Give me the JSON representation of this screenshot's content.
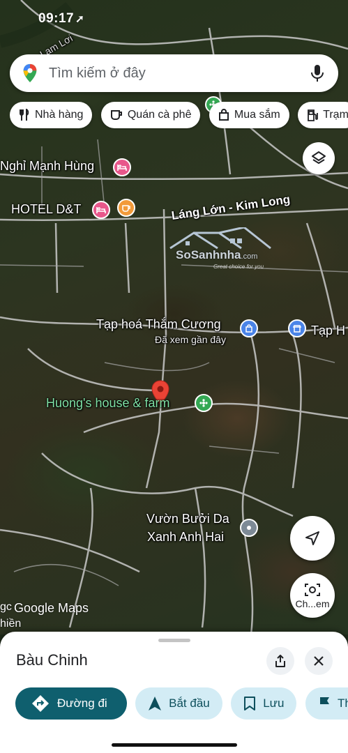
{
  "status": {
    "time": "09:17",
    "arrow": "➚"
  },
  "search": {
    "placeholder": "Tìm kiếm ở đây"
  },
  "chips": [
    {
      "label": "Nhà hàng",
      "icon": "fork-knife-icon"
    },
    {
      "label": "Quán cà phê",
      "icon": "coffee-icon"
    },
    {
      "label": "Mua sắm",
      "icon": "shopping-bag-icon"
    },
    {
      "label": "Trạm",
      "icon": "gas-station-icon"
    }
  ],
  "map": {
    "labels": {
      "top_road": "Lạm Lơi",
      "nghi_manh_hung": "Nghỉ Mạnh Hùng",
      "hotel_dt": "HOTEL D&T",
      "lang_lon": "Láng Lớn - Kim Long",
      "tap_hoa": "Tạp hoá Thắm Cương",
      "da_xem": "Đã xem gần đây",
      "tap_h": "Tạp H",
      "huongs_house": "Huong's house & farm",
      "vuon_buoi_1": "Vườn Bưởi Da",
      "vuon_buoi_2": "Xanh Anh Hai",
      "left_cut_1": "gc",
      "left_cut_2": "hiền",
      "gmaps": "Google Maps"
    },
    "watermark": {
      "brand": "SoSanhnha",
      "domain": ".com",
      "tagline": "Great choice for you"
    },
    "lens_label": "Ch...em",
    "colors": {
      "hotel": "#e8578b",
      "cafe": "#f29a3a",
      "shop": "#4a84e8",
      "farm": "#34a853",
      "pin": "#ea4335"
    }
  },
  "sheet": {
    "place_name": "Bàu Chinh",
    "actions": [
      {
        "label": "Đường đi",
        "icon": "directions-icon"
      },
      {
        "label": "Bắt đầu",
        "icon": "navigate-arrow-icon"
      },
      {
        "label": "Lưu",
        "icon": "bookmark-icon"
      },
      {
        "label": "Thê",
        "icon": "flag-icon"
      }
    ]
  }
}
